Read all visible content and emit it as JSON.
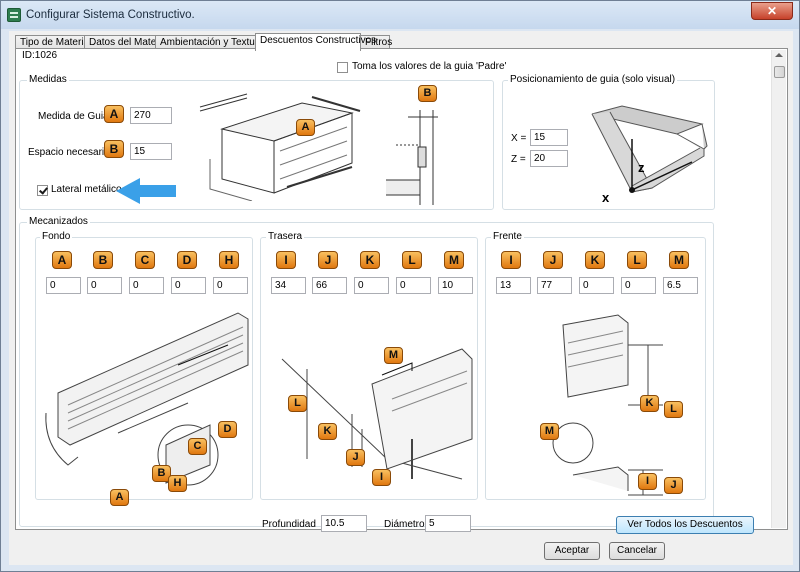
{
  "window": {
    "title": "Configurar Sistema Constructivo.",
    "close_glyph": "✕"
  },
  "tabs": [
    {
      "label": "Tipo de Material"
    },
    {
      "label": "Datos del Material"
    },
    {
      "label": "Ambientación y Texturas"
    },
    {
      "label": "Descuentos Constructivos"
    },
    {
      "label": "Filtros"
    }
  ],
  "id_label": "ID:1026",
  "parent_checkbox": {
    "label": "Toma los valores de la guia 'Padre'",
    "checked": false
  },
  "medidas": {
    "title": "Medidas",
    "guia_label": "Medida de Guia",
    "guia_badge": "A",
    "guia_value": "270",
    "espacio_label": "Espacio necesario",
    "espacio_badge": "B",
    "espacio_value": "15",
    "lateral_label": "Lateral metálico",
    "lateral_checked": true,
    "illus_badge_a": "A",
    "illus_badge_b": "B",
    "arrow_color": "#3aa0e8"
  },
  "posicionamiento": {
    "title": "Posicionamiento de guia (solo visual)",
    "x_label": "X =",
    "x_value": "15",
    "z_label": "Z =",
    "z_value": "20",
    "axis_z": "z",
    "axis_x": "x"
  },
  "mecanizados": {
    "title": "Mecanizados",
    "fondo": {
      "title": "Fondo",
      "badges": [
        "A",
        "B",
        "C",
        "D",
        "H"
      ],
      "values": [
        "0",
        "0",
        "0",
        "0",
        "0"
      ],
      "illus_badges": [
        "A",
        "B",
        "C",
        "D",
        "H"
      ]
    },
    "trasera": {
      "title": "Trasera",
      "badges": [
        "I",
        "J",
        "K",
        "L",
        "M"
      ],
      "values": [
        "34",
        "66",
        "0",
        "0",
        "10"
      ],
      "illus_badges": [
        "M",
        "L",
        "K",
        "J",
        "I"
      ]
    },
    "frente": {
      "title": "Frente",
      "badges": [
        "I",
        "J",
        "K",
        "L",
        "M"
      ],
      "values": [
        "13",
        "77",
        "0",
        "0",
        "6.5"
      ],
      "illus_badges": [
        "K",
        "L",
        "M",
        "I",
        "J"
      ]
    }
  },
  "profundidad": {
    "label": "Profundidad",
    "value": "10.5"
  },
  "diametro": {
    "label": "Diámetro",
    "value": "5"
  },
  "ver_todos_button": "Ver Todos los Descuentos",
  "aceptar_button": "Aceptar",
  "cancelar_button": "Cancelar",
  "colors": {
    "badge": "#f0a030",
    "title_bar": "#c6d8ee",
    "accent_arrow": "#3aa0e8"
  }
}
